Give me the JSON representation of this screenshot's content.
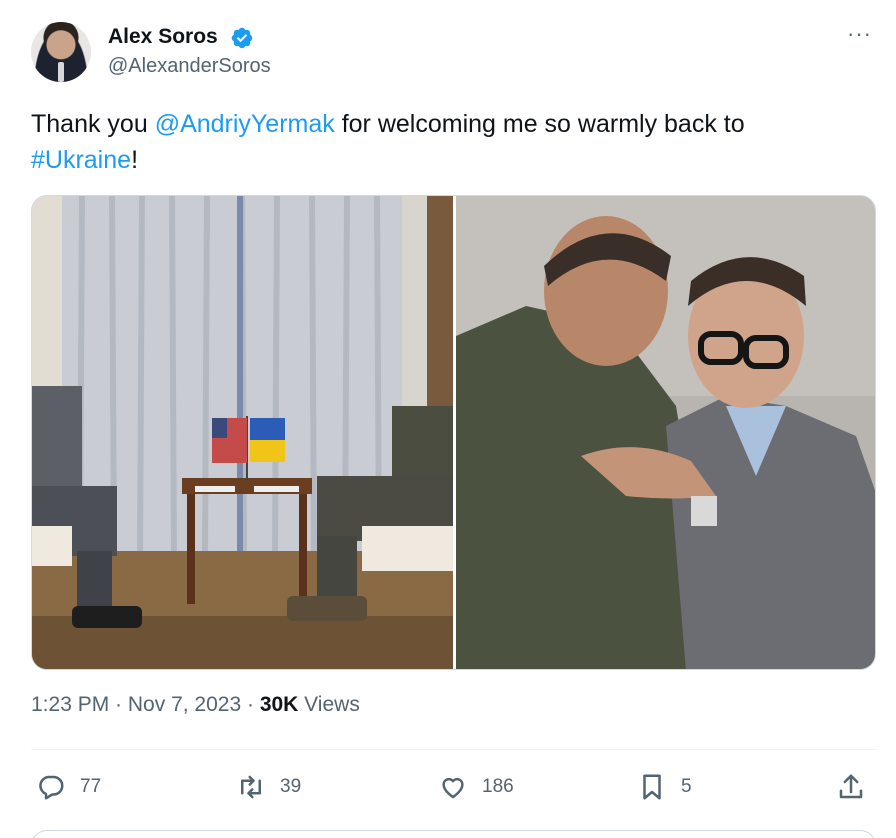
{
  "author": {
    "display_name": "Alex Soros",
    "handle": "@AlexanderSoros",
    "avatar_icon": "profile-photo",
    "verified_icon": "verified-badge-icon",
    "verified_color": "#1d9bf0"
  },
  "more_label": "···",
  "tweet_text": {
    "part1": "Thank you ",
    "mention": "@AndriyYermak",
    "part2": " for welcoming me so warmly back to ",
    "hashtag": "#Ukraine",
    "part3": "!"
  },
  "media": {
    "count": 2,
    "photo_left": "meeting-room-photo",
    "photo_right": "embrace-photo"
  },
  "meta": {
    "time": "1:23 PM",
    "separator": " · ",
    "date": "Nov 7, 2023",
    "views_count": "30K",
    "views_label": " Views"
  },
  "actions": {
    "reply_count": "77",
    "retweet_count": "39",
    "like_count": "186",
    "bookmark_count": "5"
  },
  "colors": {
    "link": "#1d9bf0",
    "text": "#0f1419",
    "secondary": "#536471"
  }
}
